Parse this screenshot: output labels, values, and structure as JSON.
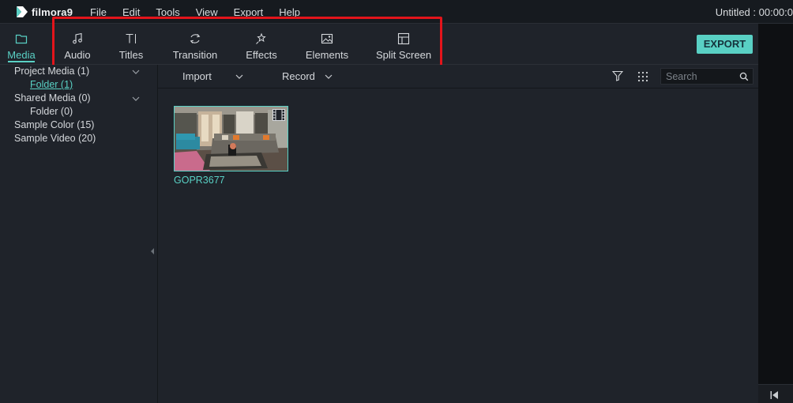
{
  "app": {
    "logo_text": "filmora9",
    "project_title": "Untitled : 00:00:0"
  },
  "menu": [
    "File",
    "Edit",
    "Tools",
    "View",
    "Export",
    "Help"
  ],
  "toolbar": {
    "tabs": [
      {
        "label": "Media",
        "icon": "folder-icon",
        "active": true
      },
      {
        "label": "Audio",
        "icon": "music-note-icon",
        "active": false
      },
      {
        "label": "Titles",
        "icon": "titles-icon",
        "active": false
      },
      {
        "label": "Transition",
        "icon": "transition-icon",
        "active": false
      },
      {
        "label": "Effects",
        "icon": "effects-icon",
        "active": false
      },
      {
        "label": "Elements",
        "icon": "image-icon",
        "active": false
      },
      {
        "label": "Split Screen",
        "icon": "split-screen-icon",
        "active": false
      }
    ],
    "export_label": "EXPORT"
  },
  "sidebar": {
    "items": [
      {
        "label": "Project Media (1)",
        "level": 0,
        "expandable": true
      },
      {
        "label": "Folder (1)",
        "level": 1,
        "selected": true
      },
      {
        "label": "Shared Media (0)",
        "level": 0,
        "expandable": true
      },
      {
        "label": "Folder (0)",
        "level": 1
      },
      {
        "label": "Sample Color (15)",
        "level": 0
      },
      {
        "label": "Sample Video (20)",
        "level": 0
      }
    ]
  },
  "content": {
    "import_label": "Import",
    "record_label": "Record",
    "search_placeholder": "Search",
    "media": [
      {
        "name": "GOPR3677",
        "type": "video"
      }
    ]
  },
  "colors": {
    "accent": "#59d0c4",
    "highlight": "#e3141b",
    "background": "#1f232a",
    "menubar": "#161a1f"
  }
}
